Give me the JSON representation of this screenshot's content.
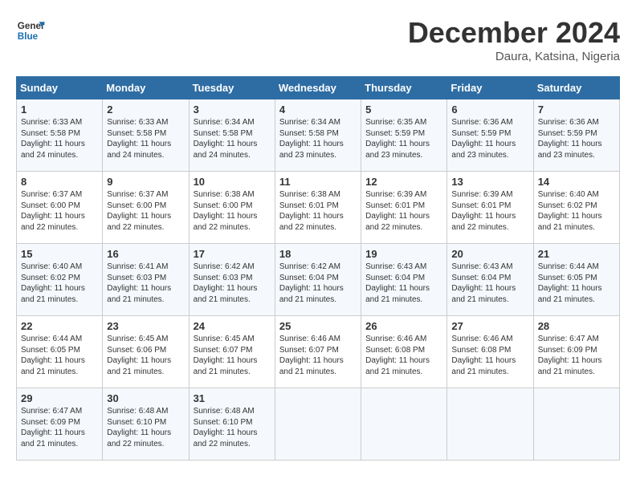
{
  "header": {
    "logo_line1": "General",
    "logo_line2": "Blue",
    "month": "December 2024",
    "location": "Daura, Katsina, Nigeria"
  },
  "days_of_week": [
    "Sunday",
    "Monday",
    "Tuesday",
    "Wednesday",
    "Thursday",
    "Friday",
    "Saturday"
  ],
  "weeks": [
    [
      {
        "day": "1",
        "text": "Sunrise: 6:33 AM\nSunset: 5:58 PM\nDaylight: 11 hours\nand 24 minutes."
      },
      {
        "day": "2",
        "text": "Sunrise: 6:33 AM\nSunset: 5:58 PM\nDaylight: 11 hours\nand 24 minutes."
      },
      {
        "day": "3",
        "text": "Sunrise: 6:34 AM\nSunset: 5:58 PM\nDaylight: 11 hours\nand 24 minutes."
      },
      {
        "day": "4",
        "text": "Sunrise: 6:34 AM\nSunset: 5:58 PM\nDaylight: 11 hours\nand 23 minutes."
      },
      {
        "day": "5",
        "text": "Sunrise: 6:35 AM\nSunset: 5:59 PM\nDaylight: 11 hours\nand 23 minutes."
      },
      {
        "day": "6",
        "text": "Sunrise: 6:36 AM\nSunset: 5:59 PM\nDaylight: 11 hours\nand 23 minutes."
      },
      {
        "day": "7",
        "text": "Sunrise: 6:36 AM\nSunset: 5:59 PM\nDaylight: 11 hours\nand 23 minutes."
      }
    ],
    [
      {
        "day": "8",
        "text": "Sunrise: 6:37 AM\nSunset: 6:00 PM\nDaylight: 11 hours\nand 22 minutes."
      },
      {
        "day": "9",
        "text": "Sunrise: 6:37 AM\nSunset: 6:00 PM\nDaylight: 11 hours\nand 22 minutes."
      },
      {
        "day": "10",
        "text": "Sunrise: 6:38 AM\nSunset: 6:00 PM\nDaylight: 11 hours\nand 22 minutes."
      },
      {
        "day": "11",
        "text": "Sunrise: 6:38 AM\nSunset: 6:01 PM\nDaylight: 11 hours\nand 22 minutes."
      },
      {
        "day": "12",
        "text": "Sunrise: 6:39 AM\nSunset: 6:01 PM\nDaylight: 11 hours\nand 22 minutes."
      },
      {
        "day": "13",
        "text": "Sunrise: 6:39 AM\nSunset: 6:01 PM\nDaylight: 11 hours\nand 22 minutes."
      },
      {
        "day": "14",
        "text": "Sunrise: 6:40 AM\nSunset: 6:02 PM\nDaylight: 11 hours\nand 21 minutes."
      }
    ],
    [
      {
        "day": "15",
        "text": "Sunrise: 6:40 AM\nSunset: 6:02 PM\nDaylight: 11 hours\nand 21 minutes."
      },
      {
        "day": "16",
        "text": "Sunrise: 6:41 AM\nSunset: 6:03 PM\nDaylight: 11 hours\nand 21 minutes."
      },
      {
        "day": "17",
        "text": "Sunrise: 6:42 AM\nSunset: 6:03 PM\nDaylight: 11 hours\nand 21 minutes."
      },
      {
        "day": "18",
        "text": "Sunrise: 6:42 AM\nSunset: 6:04 PM\nDaylight: 11 hours\nand 21 minutes."
      },
      {
        "day": "19",
        "text": "Sunrise: 6:43 AM\nSunset: 6:04 PM\nDaylight: 11 hours\nand 21 minutes."
      },
      {
        "day": "20",
        "text": "Sunrise: 6:43 AM\nSunset: 6:04 PM\nDaylight: 11 hours\nand 21 minutes."
      },
      {
        "day": "21",
        "text": "Sunrise: 6:44 AM\nSunset: 6:05 PM\nDaylight: 11 hours\nand 21 minutes."
      }
    ],
    [
      {
        "day": "22",
        "text": "Sunrise: 6:44 AM\nSunset: 6:05 PM\nDaylight: 11 hours\nand 21 minutes."
      },
      {
        "day": "23",
        "text": "Sunrise: 6:45 AM\nSunset: 6:06 PM\nDaylight: 11 hours\nand 21 minutes."
      },
      {
        "day": "24",
        "text": "Sunrise: 6:45 AM\nSunset: 6:07 PM\nDaylight: 11 hours\nand 21 minutes."
      },
      {
        "day": "25",
        "text": "Sunrise: 6:46 AM\nSunset: 6:07 PM\nDaylight: 11 hours\nand 21 minutes."
      },
      {
        "day": "26",
        "text": "Sunrise: 6:46 AM\nSunset: 6:08 PM\nDaylight: 11 hours\nand 21 minutes."
      },
      {
        "day": "27",
        "text": "Sunrise: 6:46 AM\nSunset: 6:08 PM\nDaylight: 11 hours\nand 21 minutes."
      },
      {
        "day": "28",
        "text": "Sunrise: 6:47 AM\nSunset: 6:09 PM\nDaylight: 11 hours\nand 21 minutes."
      }
    ],
    [
      {
        "day": "29",
        "text": "Sunrise: 6:47 AM\nSunset: 6:09 PM\nDaylight: 11 hours\nand 21 minutes."
      },
      {
        "day": "30",
        "text": "Sunrise: 6:48 AM\nSunset: 6:10 PM\nDaylight: 11 hours\nand 22 minutes."
      },
      {
        "day": "31",
        "text": "Sunrise: 6:48 AM\nSunset: 6:10 PM\nDaylight: 11 hours\nand 22 minutes."
      },
      {
        "day": "",
        "text": ""
      },
      {
        "day": "",
        "text": ""
      },
      {
        "day": "",
        "text": ""
      },
      {
        "day": "",
        "text": ""
      }
    ]
  ]
}
